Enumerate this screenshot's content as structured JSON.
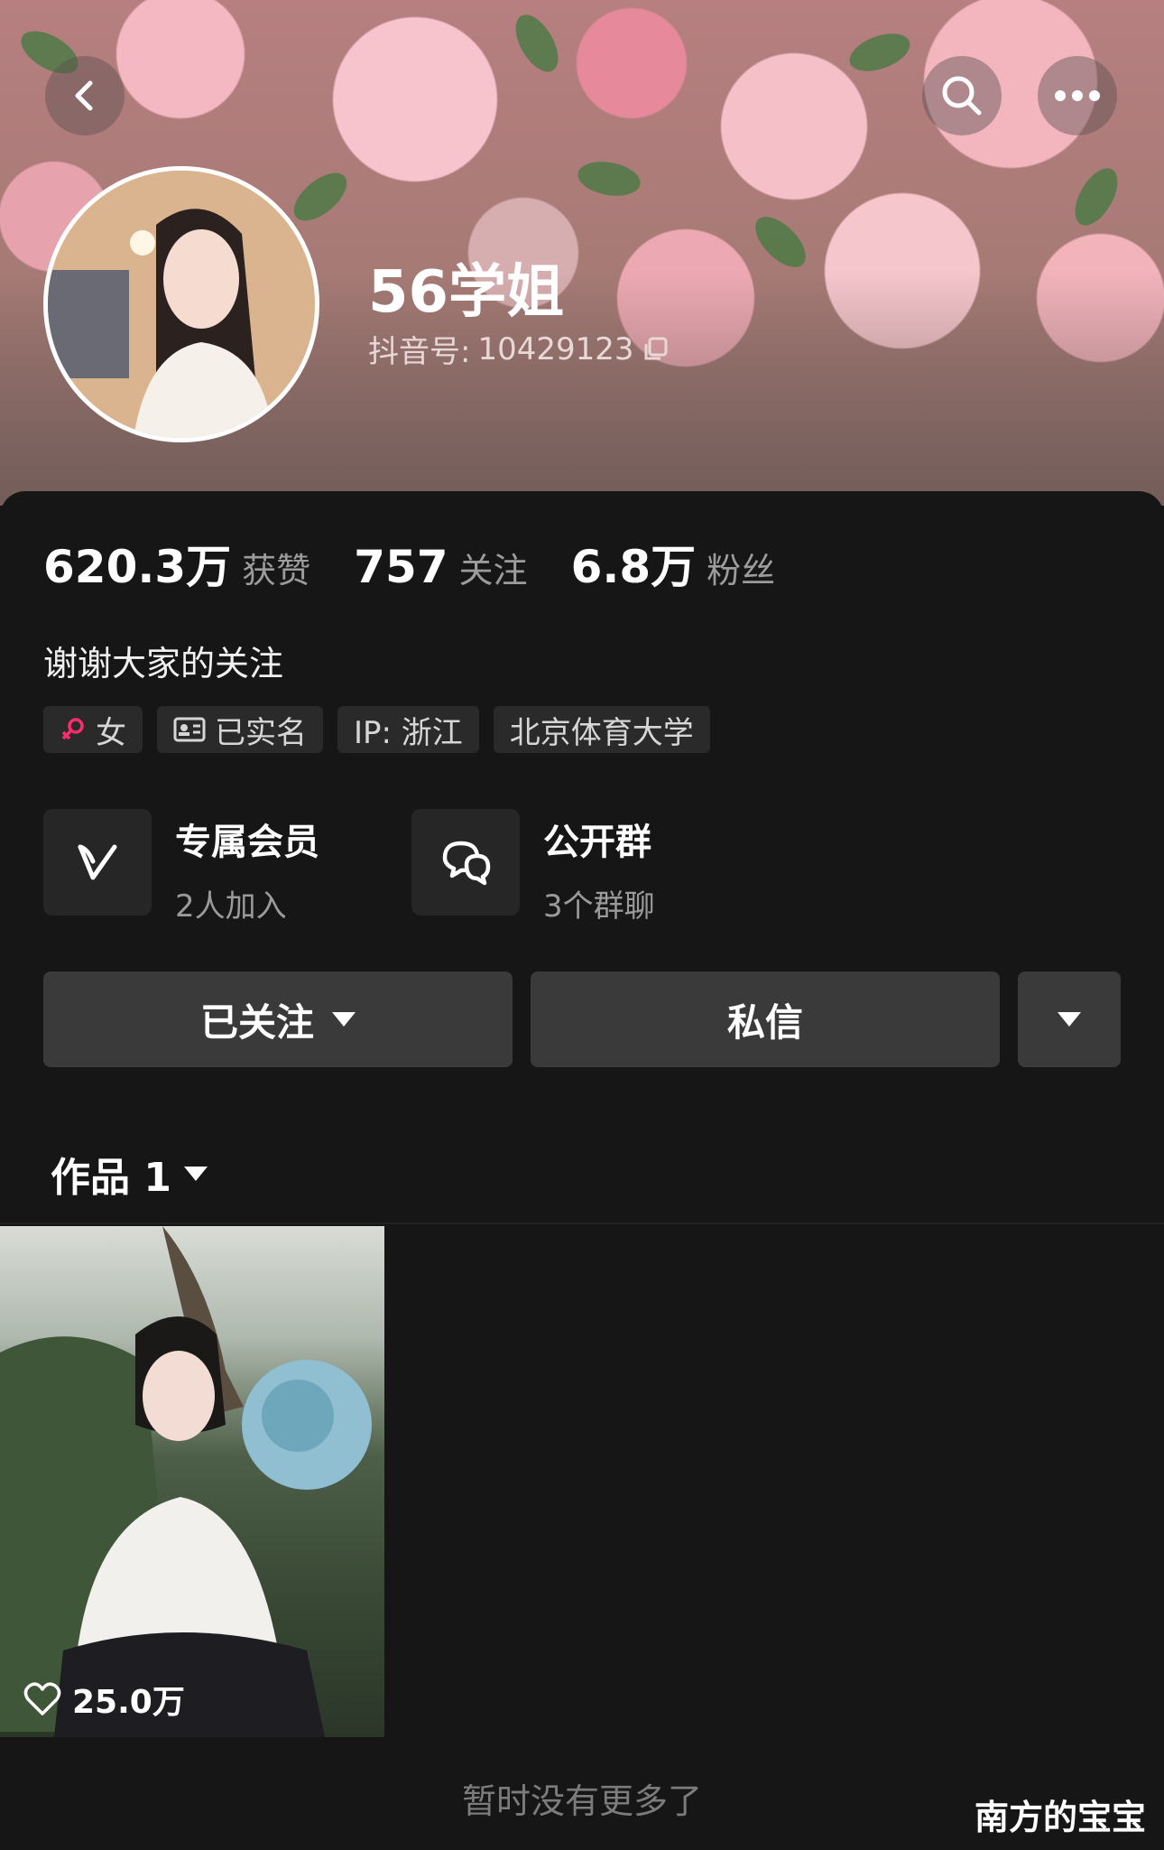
{
  "profile": {
    "name": "56学姐",
    "douyin_id_label": "抖音号:",
    "douyin_id": "10429123"
  },
  "stats": [
    {
      "value": "620.3万",
      "label": "获赞"
    },
    {
      "value": "757",
      "label": "关注"
    },
    {
      "value": "6.8万",
      "label": "粉丝"
    }
  ],
  "bio": "谢谢大家的关注",
  "tags": {
    "gender": "女",
    "verified": "已实名",
    "ip": "IP: 浙江",
    "school": "北京体育大学"
  },
  "features": {
    "member": {
      "title": "专属会员",
      "sub": "2人加入"
    },
    "group": {
      "title": "公开群",
      "sub": "3个群聊"
    }
  },
  "actions": {
    "follow": "已关注",
    "message": "私信"
  },
  "works": {
    "tab_label": "作品 1",
    "items": [
      {
        "likes": "25.0万"
      }
    ]
  },
  "footer": {
    "end_text": "暂时没有更多了",
    "watermark": "南方的宝宝"
  },
  "colors": {
    "background": "#161616",
    "button": "#3a3a3a",
    "tag": "#2a2a2a",
    "gender_icon": "#ff2d6f"
  },
  "icons": [
    "back-icon",
    "search-icon",
    "more-icon",
    "copy-icon",
    "female-icon",
    "id-card-icon",
    "vip-icon",
    "chat-group-icon",
    "dropdown-icon",
    "heart-icon"
  ]
}
